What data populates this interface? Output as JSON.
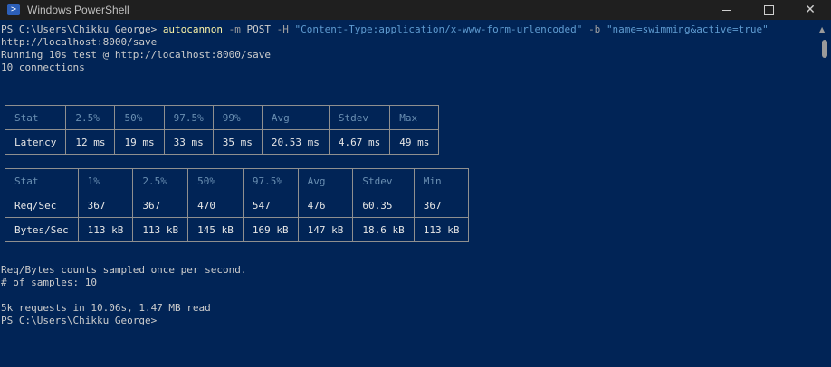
{
  "window": {
    "title": "Windows PowerShell"
  },
  "console": {
    "prompt": "PS C:\\Users\\Chikku George>",
    "command": {
      "exe": "autocannon",
      "args": [
        {
          "kind": "param",
          "text": "-m"
        },
        {
          "kind": "plain",
          "text": "POST"
        },
        {
          "kind": "param",
          "text": "-H"
        },
        {
          "kind": "str",
          "text": "\"Content-Type:application/x-www-form-urlencoded\""
        },
        {
          "kind": "param",
          "text": "-b"
        },
        {
          "kind": "str",
          "text": "\"name=swimming&active=true\""
        }
      ]
    },
    "lines": [
      "http://localhost:8000/save",
      "Running 10s test @ http://localhost:8000/save",
      "10 connections"
    ],
    "latency_table": {
      "headers": [
        "Stat",
        "2.5%",
        "50%",
        "97.5%",
        "99%",
        "Avg",
        "Stdev",
        "Max"
      ],
      "rows": [
        [
          "Latency",
          "12 ms",
          "19 ms",
          "33 ms",
          "35 ms",
          "20.53 ms",
          "4.67 ms",
          "49 ms"
        ]
      ]
    },
    "throughput_table": {
      "headers": [
        "Stat",
        "1%",
        "2.5%",
        "50%",
        "97.5%",
        "Avg",
        "Stdev",
        "Min"
      ],
      "rows": [
        [
          "Req/Sec",
          "367",
          "367",
          "470",
          "547",
          "476",
          "60.35",
          "367"
        ],
        [
          "Bytes/Sec",
          "113 kB",
          "113 kB",
          "145 kB",
          "169 kB",
          "147 kB",
          "18.6 kB",
          "113 kB"
        ]
      ]
    },
    "summary": [
      "Req/Bytes counts sampled once per second.",
      "# of samples: 10",
      "5k requests in 10.06s, 1.47 MB read"
    ],
    "final_prompt": "PS C:\\Users\\Chikku George>"
  },
  "colors": {
    "background": "#012456",
    "text": "#cccccc",
    "command": "#f9f1a5",
    "string": "#5f9bd0",
    "header": "#6a8fb2",
    "row_label": "#f1ea7a"
  },
  "icons": [
    "powershell-icon",
    "minimize-icon",
    "maximize-icon",
    "close-icon",
    "scroll-up-arrow-icon"
  ]
}
